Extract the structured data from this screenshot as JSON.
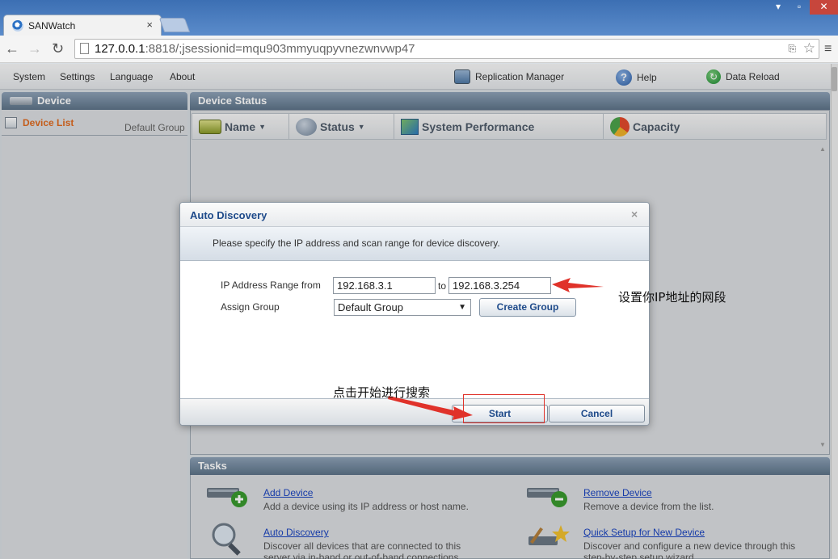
{
  "browser": {
    "tab_title": "SANWatch",
    "tab_close": "×",
    "url_host": "127.0.0.1",
    "url_rest": ":8818/;jsessionid=mqu903mmyuqpyvnezwnvwp47"
  },
  "menubar": {
    "system": "System",
    "settings": "Settings",
    "language": "Language",
    "about": "About",
    "replication_manager": "Replication Manager",
    "help": "Help",
    "data_reload": "Data Reload"
  },
  "left_panel": {
    "title": "Device",
    "device_list": "Device List",
    "default_group": "Default Group"
  },
  "device_status": {
    "title": "Device Status",
    "columns": {
      "name": "Name",
      "status": "Status",
      "performance": "System Performance",
      "capacity": "Capacity"
    }
  },
  "tasks": {
    "title": "Tasks",
    "add_device": {
      "link": "Add Device",
      "desc": "Add a device using its IP address or host name."
    },
    "remove_device": {
      "link": "Remove Device",
      "desc": "Remove a device from the list."
    },
    "auto_discovery": {
      "link": "Auto Discovery",
      "desc1": "Discover all devices that are connected to this",
      "desc2": "server via in-band or out-of-band connections."
    },
    "quick_setup": {
      "link": "Quick Setup for New Device",
      "desc1": "Discover and configure a new device through this",
      "desc2": "step-by-step setup wizard."
    }
  },
  "modal": {
    "title": "Auto Discovery",
    "close": "×",
    "description": "Please specify the IP address and scan range for device discovery.",
    "ip_range_label": "IP Address Range from",
    "to_label": "to",
    "ip_from": "192.168.3.1",
    "ip_to": "192.168.3.254",
    "assign_group_label": "Assign Group",
    "group_selected": "Default Group",
    "create_group": "Create Group",
    "start": "Start",
    "cancel": "Cancel"
  },
  "annotations": {
    "ip_note": "设置你IP地址的网段",
    "start_note": "点击开始进行搜索"
  },
  "colors": {
    "annotation_red": "#e0322a",
    "link_blue": "#1a44c0",
    "device_list_orange": "#e06a1f"
  }
}
